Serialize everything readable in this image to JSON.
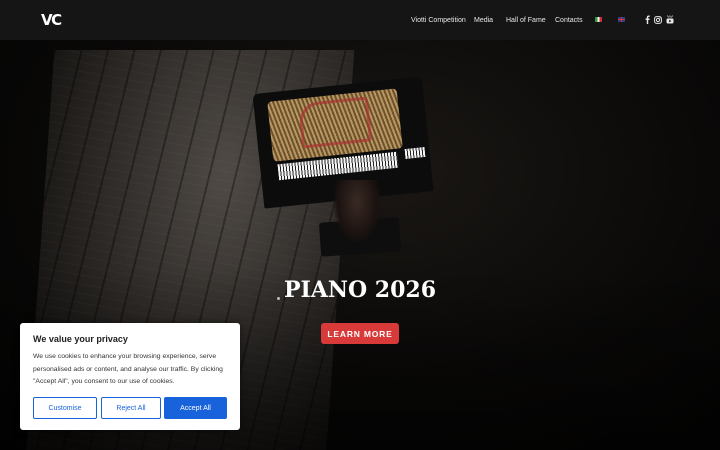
{
  "header": {
    "logo": "VC",
    "nav": [
      {
        "label": "Viotti Competition"
      },
      {
        "label": "Media"
      },
      {
        "label": "Hall of Fame"
      },
      {
        "label": "Contacts"
      }
    ],
    "languages": [
      {
        "icon": "italian-flag-icon"
      },
      {
        "icon": "english-flag-icon"
      }
    ],
    "social": [
      {
        "icon": "facebook-icon",
        "glyph": "f"
      },
      {
        "icon": "instagram-icon",
        "glyph": "◎"
      },
      {
        "icon": "youtube-icon",
        "glyph": "▶"
      }
    ]
  },
  "hero": {
    "title": "PIANO 2026",
    "cta_label": "LEARN MORE",
    "cta_color": "#d83a3a"
  },
  "cookie_banner": {
    "title": "We value your privacy",
    "text": "We use cookies to enhance your browsing experience, serve personalised ads or content, and analyse our traffic. By clicking \"Accept All\", you consent to our use of cookies.",
    "customise_label": "Customise",
    "reject_label": "Reject All",
    "accept_label": "Accept All",
    "accent_color": "#1863dc"
  }
}
